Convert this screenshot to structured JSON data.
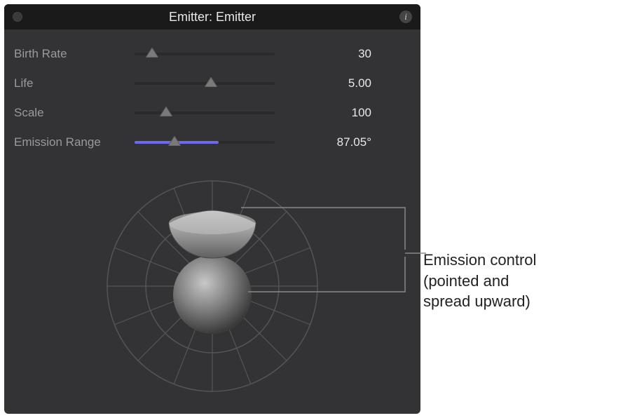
{
  "title": "Emitter: Emitter",
  "params": {
    "birth_rate": {
      "label": "Birth Rate",
      "value": "30",
      "slider_pct": 8,
      "fill_pct": 0
    },
    "life": {
      "label": "Life",
      "value": "5.00",
      "slider_pct": 50,
      "fill_pct": 0
    },
    "scale": {
      "label": "Scale",
      "value": "100",
      "slider_pct": 18,
      "fill_pct": 0
    },
    "emission_range": {
      "label": "Emission Range",
      "value": "87.05°",
      "slider_pct": 24,
      "fill_pct": 60
    }
  },
  "annotation": {
    "line1": "Emission control",
    "line2": "(pointed and",
    "line3": "spread upward)"
  },
  "chart_data": {
    "type": "table",
    "title": "Emitter parameters",
    "categories": [
      "Birth Rate",
      "Life",
      "Scale",
      "Emission Range"
    ],
    "values": [
      30,
      5.0,
      100,
      87.05
    ]
  }
}
